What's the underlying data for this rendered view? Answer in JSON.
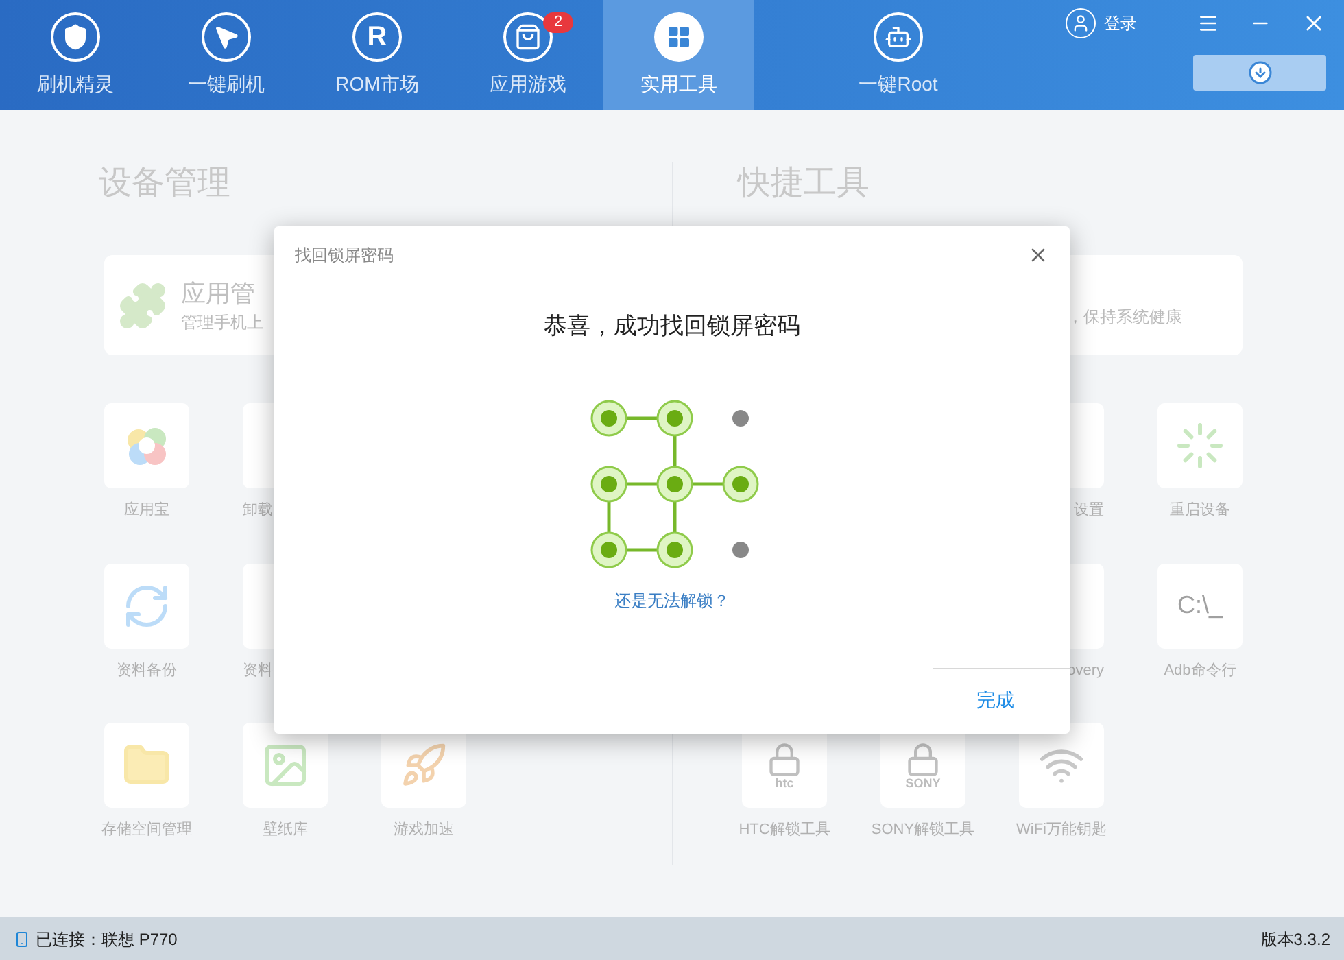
{
  "nav": {
    "tabs": [
      {
        "label": "刷机精灵",
        "kind": "shield",
        "selected": false
      },
      {
        "label": "一键刷机",
        "kind": "cursor",
        "selected": false
      },
      {
        "label": "ROM市场",
        "kind": "glyph",
        "glyph": "R",
        "selected": false
      },
      {
        "label": "应用游戏",
        "kind": "bag",
        "badge": "2",
        "selected": false
      },
      {
        "label": "实用工具",
        "kind": "grid",
        "selected": true
      },
      {
        "label": "一键Root",
        "kind": "robot",
        "selected": false
      }
    ],
    "login": "登录"
  },
  "device_section": {
    "title": "设备管理",
    "card": {
      "title": "应用管",
      "subtitle": "管理手机上"
    },
    "rows": [
      [
        {
          "label": "应用宝",
          "kind": "swirl"
        },
        {
          "label": "卸载",
          "kind": "cut"
        }
      ],
      [
        {
          "label": "资料备份",
          "kind": "refresh"
        },
        {
          "label": "资料",
          "kind": "cut"
        }
      ],
      [
        {
          "label": "存储空间管理",
          "kind": "folder"
        },
        {
          "label": "壁纸库",
          "kind": "picture"
        },
        {
          "label": "游戏加速",
          "kind": "rocket"
        }
      ]
    ]
  },
  "tools_section": {
    "title": "快捷工具",
    "card": {
      "subtitle": "，保持系统健康"
    },
    "rows": [
      [
        null,
        null,
        {
          "label": "设置",
          "kind": "cut"
        },
        {
          "label": "重启设备",
          "kind": "spinner"
        }
      ],
      [
        null,
        null,
        {
          "label": "overy",
          "kind": "cut"
        },
        {
          "label": "Adb命令行",
          "kind": "terminal",
          "glyph": "C:\\_"
        }
      ],
      [
        {
          "label": "HTC解锁工具",
          "kind": "lock",
          "glyph": "htc"
        },
        {
          "label": "SONY解锁工具",
          "kind": "lock",
          "glyph": "SONY"
        },
        {
          "label": "WiFi万能钥匙",
          "kind": "wifi"
        }
      ]
    ]
  },
  "dialog": {
    "title": "找回锁屏密码",
    "heading": "恭喜，成功找回锁屏密码",
    "dots": [
      {
        "selected": true
      },
      {
        "selected": true
      },
      {
        "selected": false
      },
      {
        "selected": true
      },
      {
        "selected": true
      },
      {
        "selected": true
      },
      {
        "selected": true
      },
      {
        "selected": true
      },
      {
        "selected": false
      }
    ],
    "link": "还是无法解锁？",
    "button": "完成"
  },
  "status_bar": {
    "connection": "已连接：联想 P770",
    "version": "版本3.3.2"
  }
}
